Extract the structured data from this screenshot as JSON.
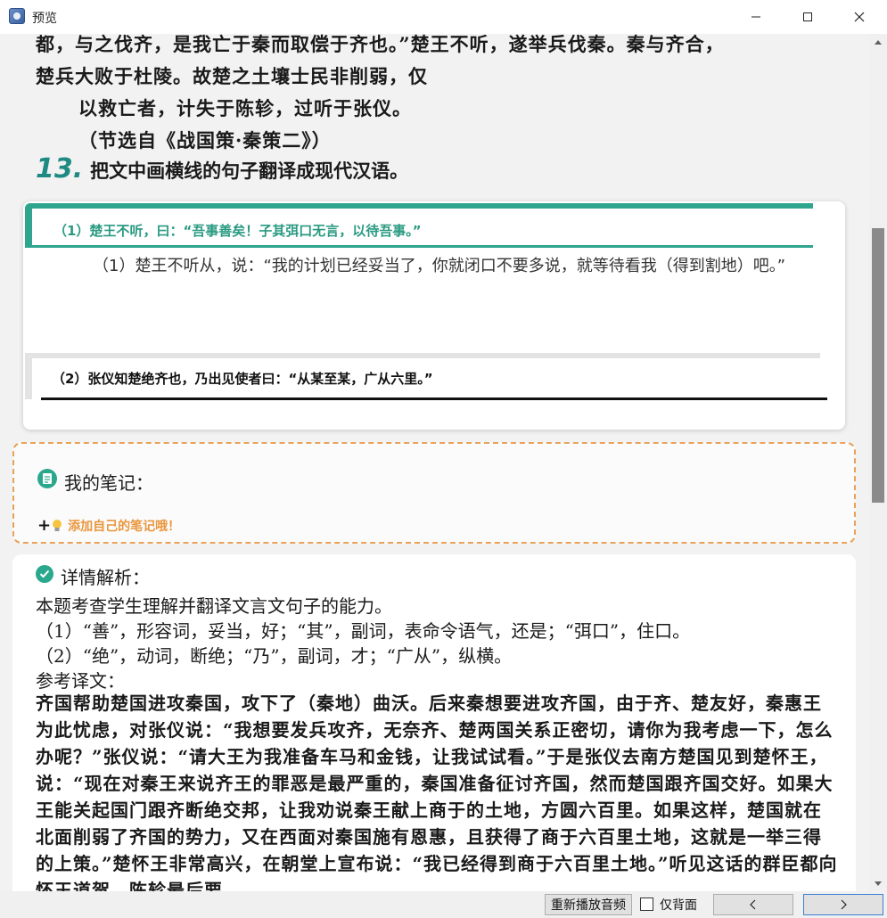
{
  "window": {
    "title": "预览"
  },
  "passage": {
    "lines": [
      "都，与之伐齐，是我亡于秦而取偿于齐也。”楚王不听，遂举兵伐秦。秦与齐合，",
      "楚兵大败于杜陵。故楚之土壤士民非削弱，仅",
      "以救亡者，计失于陈轸，过听于张仪。",
      "（节选自《战国策·秦策二》）"
    ]
  },
  "question": {
    "number": "13.",
    "text": "把文中画横线的句子翻译成现代汉语。"
  },
  "answer": {
    "sub1_label": "（1）楚王不听，曰：“吾事善矣！子其弭口无言，以待吾事。”",
    "sub1_answer": "（1）楚王不听从，说：“我的计划已经妥当了，你就闭口不要多说，就等待看我（得到割地）吧。”",
    "sub2_label": "（2）张仪知楚绝齐也，乃出见使者曰：“从某至某，广从六里。”"
  },
  "notes": {
    "title": "我的笔记：",
    "add_label": "添加自己的笔记哦！"
  },
  "analysis": {
    "title": "详情解析：",
    "lines": [
      "本题考查学生理解并翻译文言文句子的能力。",
      "（1）“善”，形容词，妥当，好；“其”，副词，表命令语气，还是；“弭口”，住口。",
      "（2）“绝”，动词，断绝；“乃”，副词，才；“广从”，纵横。",
      "参考译文："
    ],
    "translation": "齐国帮助楚国进攻秦国，攻下了（秦地）曲沃。后来秦想要进攻齐国，由于齐、楚友好，秦惠王为此忧虑，对张仪说：“我想要发兵攻齐，无奈齐、楚两国关系正密切，请你为我考虑一下，怎么办呢？”张仪说：“请大王为我准备车马和金钱，让我试试看。”于是张仪去南方楚国见到楚怀王，说：“现在对秦王来说齐王的罪恶是最严重的，秦国准备征讨齐国，然而楚国跟齐国交好。如果大王能关起国门跟齐断绝交邦，让我劝说秦王献上商于的土地，方圆六百里。如果这样，楚国就在北面削弱了齐国的势力，又在西面对秦国施有恩惠，且获得了商于六百里土地，这就是一举三得的上策。”楚怀王非常高兴，在朝堂上宣布说：“我已经得到商于六百里土地。”听见这话的群臣都向怀王道贺，陈轸最后要"
  },
  "bottombar": {
    "replay_label": "重新播放音频",
    "back_only_label": "仅背面",
    "back_only_checked": false
  },
  "colors": {
    "accent_teal": "#2fa58e",
    "notes_orange": "#e9973e"
  },
  "icons": {
    "app": "preview-app-icon",
    "notes": "note-icon",
    "add": "plus-icon",
    "bulb": "lightbulb-icon",
    "analysis": "check-circle-icon",
    "prev": "chevron-left-icon",
    "next": "chevron-right-icon"
  }
}
